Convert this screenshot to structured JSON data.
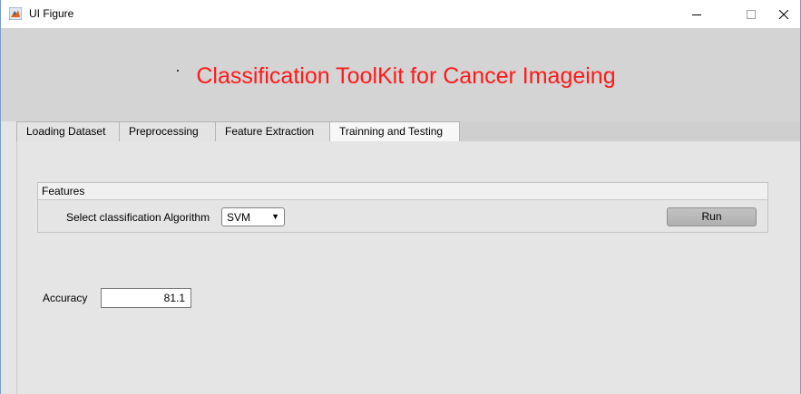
{
  "window": {
    "title": "UI Figure",
    "icon": "matlab-icon",
    "controls": {
      "minimize_icon": "minimize-icon",
      "maximize_icon": "maximize-icon",
      "close_icon": "close-icon"
    }
  },
  "header": {
    "title": "Classification ToolKit for Cancer Imageing",
    "title_color": "#ff1a1a"
  },
  "tabs": [
    {
      "label": "Loading Dataset",
      "selected": false
    },
    {
      "label": "Preprocessing",
      "selected": false
    },
    {
      "label": "Feature Extraction",
      "selected": false
    },
    {
      "label": "Trainning and Testing",
      "selected": true
    }
  ],
  "features_panel": {
    "title": "Features",
    "algorithm_label": "Select classification Algorithm",
    "algorithm_selected": "SVM",
    "run_label": "Run"
  },
  "accuracy": {
    "label": "Accuracy",
    "value": "81.1"
  }
}
